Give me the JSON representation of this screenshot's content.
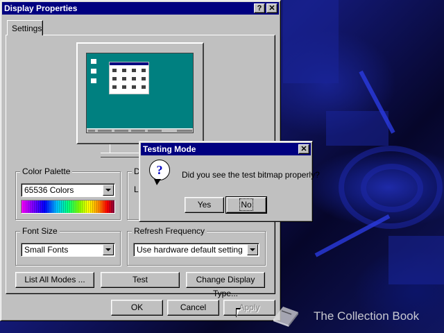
{
  "window": {
    "title": "Display Properties",
    "help_glyph": "?",
    "close_glyph": "✕"
  },
  "tabs": [
    {
      "label": "Settings"
    }
  ],
  "color_palette": {
    "label": "Color Palette",
    "selected": "65536 Colors"
  },
  "desktop_area": {
    "label_fragment": "D",
    "text_fragment": "L"
  },
  "font_size": {
    "label": "Font Size",
    "selected": "Small Fonts"
  },
  "refresh_frequency": {
    "label": "Refresh Frequency",
    "selected": "Use hardware default setting"
  },
  "buttons": {
    "list_all_modes": "List All Modes ...",
    "test": "Test",
    "change_display_type": "Change Display Type..."
  },
  "footer": {
    "ok": "OK",
    "cancel": "Cancel",
    "apply": "Apply"
  },
  "dialog": {
    "title": "Testing Mode",
    "close_glyph": "✕",
    "message": "Did you see the test bitmap properly?",
    "yes": "Yes",
    "no": "No"
  },
  "watermark": {
    "text": "The Collection Book"
  },
  "colors": {
    "titlebar": "#000080",
    "face": "#c0c0c0",
    "preview_desktop": "#008080"
  }
}
